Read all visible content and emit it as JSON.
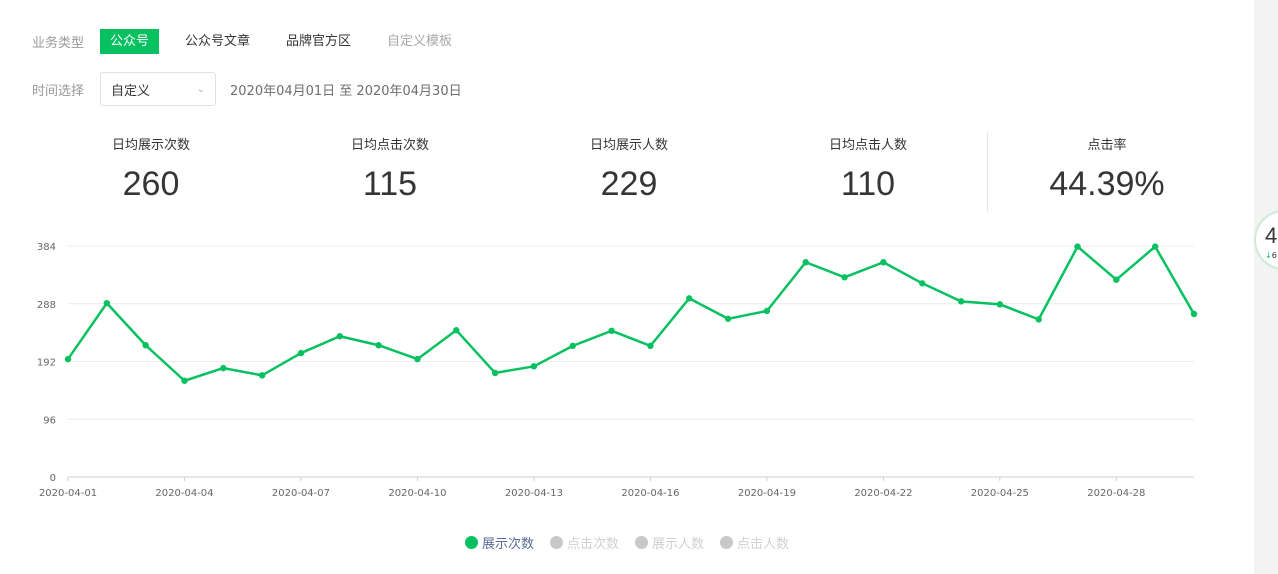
{
  "filters": {
    "business_label": "业务类型",
    "business_options": [
      {
        "label": "公众号",
        "state": "active"
      },
      {
        "label": "公众号文章",
        "state": "normal"
      },
      {
        "label": "品牌官方区",
        "state": "normal"
      },
      {
        "label": "自定义模板",
        "state": "disabled"
      }
    ],
    "time_label": "时间选择",
    "time_select_value": "自定义",
    "date_range": "2020年04月01日 至 2020年04月30日"
  },
  "stats": [
    {
      "label": "日均展示次数",
      "value": "260"
    },
    {
      "label": "日均点击次数",
      "value": "115"
    },
    {
      "label": "日均展示人数",
      "value": "229"
    },
    {
      "label": "日均点击人数",
      "value": "110"
    },
    {
      "label": "点击率",
      "value": "44.39%"
    }
  ],
  "floating_badge": {
    "value": "4",
    "delta": "6"
  },
  "colors": {
    "accent": "#07c160",
    "inactive": "#c4c4c4"
  },
  "chart_data": {
    "type": "line",
    "title": "",
    "xlabel": "",
    "ylabel": "",
    "ylim": [
      0,
      384
    ],
    "yticks": [
      0,
      96,
      192,
      288,
      384
    ],
    "grid": true,
    "legend_position": "bottom-center",
    "x": [
      "2020-04-01",
      "2020-04-02",
      "2020-04-03",
      "2020-04-04",
      "2020-04-05",
      "2020-04-06",
      "2020-04-07",
      "2020-04-08",
      "2020-04-09",
      "2020-04-10",
      "2020-04-11",
      "2020-04-12",
      "2020-04-13",
      "2020-04-14",
      "2020-04-15",
      "2020-04-16",
      "2020-04-17",
      "2020-04-18",
      "2020-04-19",
      "2020-04-20",
      "2020-04-21",
      "2020-04-22",
      "2020-04-23",
      "2020-04-24",
      "2020-04-25",
      "2020-04-26",
      "2020-04-27",
      "2020-04-28",
      "2020-04-29",
      "2020-04-30"
    ],
    "xtick_labels": [
      "2020-04-01",
      "2020-04-04",
      "2020-04-07",
      "2020-04-10",
      "2020-04-13",
      "2020-04-16",
      "2020-04-19",
      "2020-04-22",
      "2020-04-25",
      "2020-04-28"
    ],
    "series": [
      {
        "name": "展示次数",
        "active": true,
        "color": "#07c160",
        "values": [
          196,
          289,
          219,
          160,
          181,
          169,
          206,
          234,
          219,
          196,
          244,
          173,
          184,
          218,
          243,
          218,
          297,
          263,
          276,
          357,
          332,
          357,
          322,
          292,
          287,
          262,
          383,
          328,
          383,
          271
        ]
      },
      {
        "name": "点击次数",
        "active": false,
        "color": "#c4c4c4",
        "values": []
      },
      {
        "name": "展示人数",
        "active": false,
        "color": "#c4c4c4",
        "values": []
      },
      {
        "name": "点击人数",
        "active": false,
        "color": "#c4c4c4",
        "values": []
      }
    ]
  }
}
